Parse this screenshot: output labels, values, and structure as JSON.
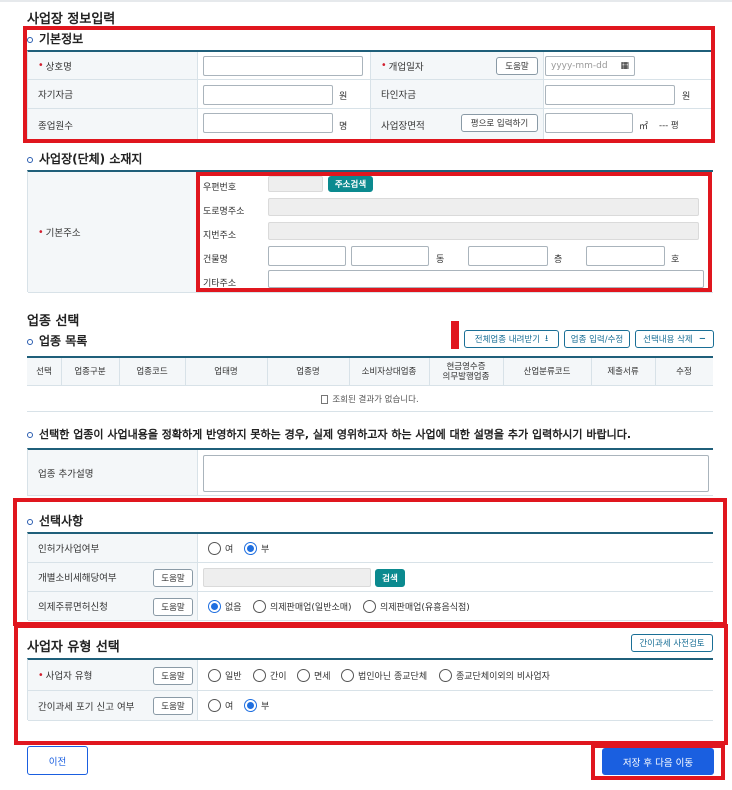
{
  "page": {
    "title": "사업장 정보입력"
  },
  "basic": {
    "heading": "기본정보",
    "trade_name": "상호명",
    "open_date": "개업일자",
    "help": "도움말",
    "date_placeholder": "yyyy-mm-dd",
    "own_capital": "자기자금",
    "other_capital": "타인자금",
    "won": "원",
    "employees": "종업원수",
    "person_unit": "명",
    "area": "사업장면적",
    "pyeong_button": "평으로 입력하기",
    "sqm": "㎡",
    "pyeong_unit": "--- 평"
  },
  "address": {
    "heading": "사업장(단체) 소재지",
    "label": "기본주소",
    "postal": "우편번호",
    "search_button": "주소검색",
    "road": "도로명주소",
    "lot": "지번주소",
    "building": "건물명",
    "dong": "동",
    "floor": "층",
    "ho": "호",
    "other": "기타주소"
  },
  "industry": {
    "title": "업종 선택",
    "list_heading": "업종 목록",
    "download_button": "전체업종 내려받기",
    "edit_button": "업종 입력/수정",
    "delete_button": "선택내용 삭제",
    "columns": [
      "선택",
      "업종구분",
      "업종코드",
      "업태명",
      "업종명",
      "소비자상대업종",
      "현금영수증\n의무발행업종",
      "산업분류코드",
      "제출서류",
      "수정"
    ],
    "empty": "조회된 결과가 없습니다.",
    "notice": "선택한 업종이 사업내용을 정확하게 반영하지 못하는 경우, 실제 영위하고자 하는 사업에 대한 설명을 추가 입력하시기 바랍니다.",
    "extra_label": "업종 추가설명"
  },
  "options": {
    "heading": "선택사항",
    "permit_label": "인허가사업여부",
    "permit_yes": "여",
    "permit_no": "부",
    "excise_label": "개별소비세해당여부",
    "help": "도움말",
    "search_button": "검색",
    "liquor_label": "의제주류면허신청",
    "liquor_none": "없음",
    "liquor_general": "의제판매업(일반소매)",
    "liquor_entertain": "의제판매업(유흥음식점)"
  },
  "biztype": {
    "title": "사업자 유형 선택",
    "simple_check_button": "간이과세 사전검토",
    "type_label": "사업자 유형",
    "help": "도움말",
    "type_general": "일반",
    "type_simple": "간이",
    "type_exempt": "면세",
    "type_nonprofit": "법인아닌 종교단체",
    "type_other": "종교단체이외의 비사업자",
    "waiver_label": "간이과세 포기 신고 여부",
    "waiver_yes": "여",
    "waiver_no": "부"
  },
  "footer": {
    "prev_button": "이전",
    "next_button": "저장 후 다음 이동"
  },
  "colors": {
    "highlight": "#e0161e",
    "teal": "#0b8a8f",
    "primary": "#1a5fe0"
  }
}
